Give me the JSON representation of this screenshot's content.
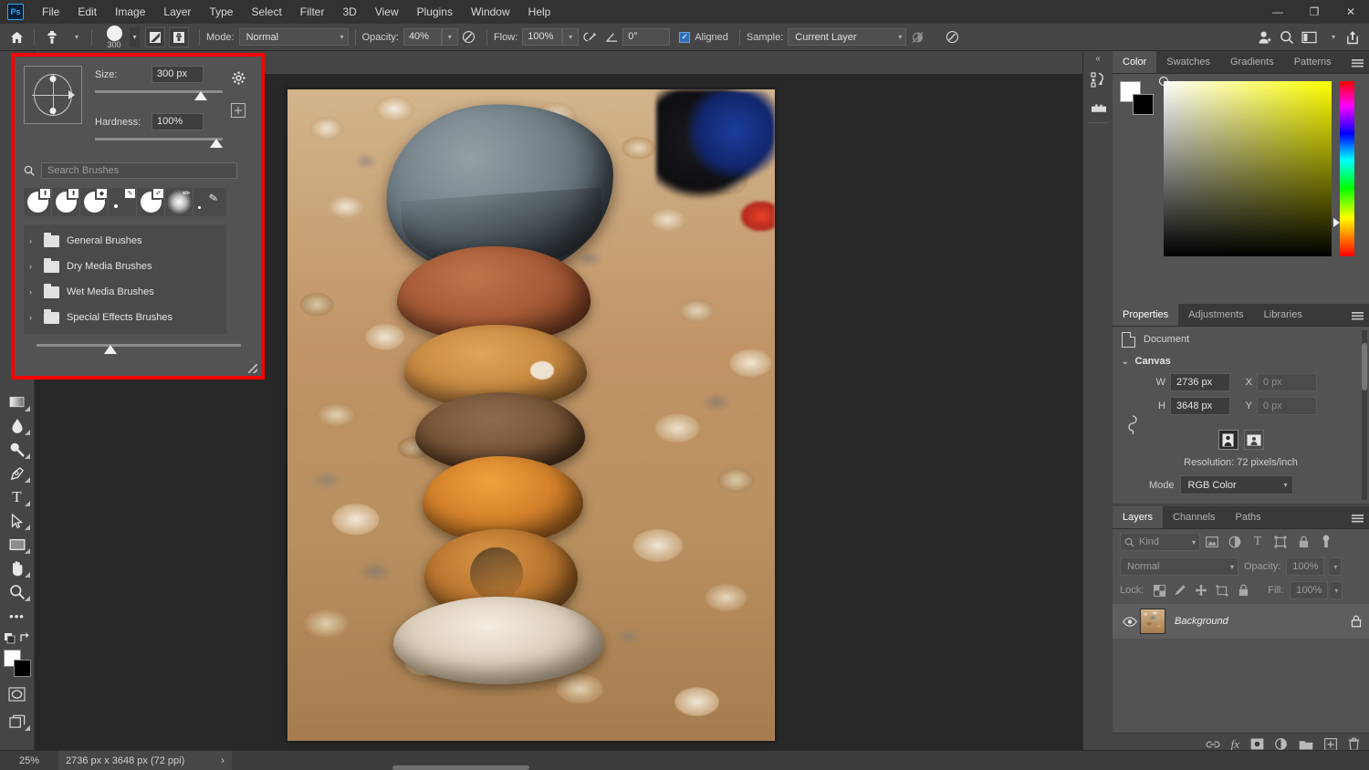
{
  "app": {
    "logo": "Ps",
    "menus": [
      "File",
      "Edit",
      "Image",
      "Layer",
      "Type",
      "Select",
      "Filter",
      "3D",
      "View",
      "Plugins",
      "Window",
      "Help"
    ],
    "window_controls": {
      "minimize": "—",
      "restore": "❐",
      "close": "✕"
    }
  },
  "options_bar": {
    "home_icon": "home-icon",
    "tool_icon": "clone-stamp-icon",
    "brush_size_value": "300",
    "mode_label": "Mode:",
    "mode_value": "Normal",
    "opacity_label": "Opacity:",
    "opacity_value": "40%",
    "flow_label": "Flow:",
    "flow_value": "100%",
    "angle_value": "0°",
    "aligned_label": "Aligned",
    "aligned_checked": true,
    "sample_label": "Sample:",
    "sample_value": "Current Layer",
    "right_icons": [
      "share-user-icon",
      "search-icon",
      "workspace-icon",
      "share-export-icon"
    ]
  },
  "toolbar": {
    "tools": [
      {
        "name": "gradient-tool",
        "glyph": "▧"
      },
      {
        "name": "blur-tool",
        "glyph": "💧"
      },
      {
        "name": "dodge-tool",
        "glyph": "🔍"
      },
      {
        "name": "pen-tool",
        "glyph": "✒"
      },
      {
        "name": "type-tool",
        "glyph": "T"
      },
      {
        "name": "path-selection-tool",
        "glyph": "➤"
      },
      {
        "name": "rectangle-tool",
        "glyph": "▭"
      },
      {
        "name": "hand-tool",
        "glyph": "✋"
      },
      {
        "name": "zoom-tool",
        "glyph": "🔎"
      },
      {
        "name": "more-tools",
        "glyph": "•••"
      }
    ],
    "foreground_color": "#ffffff",
    "background_color": "#000000",
    "quick_mask": "quick-mask-icon",
    "screen_mode": "screen-mode-icon"
  },
  "brush_panel": {
    "size_label": "Size:",
    "size_value": "300 px",
    "size_slider_pct": 80,
    "hardness_label": "Hardness:",
    "hardness_value": "100%",
    "hardness_slider_pct": 100,
    "search_placeholder": "Search Brushes",
    "gear_icon": "gear-icon",
    "new_brush_icon": "new-brush-icon",
    "presets": [
      {
        "name": "soft-round-stamp",
        "type": "hard",
        "badge": "⬆"
      },
      {
        "name": "hard-round-stamp",
        "type": "hard",
        "badge": "⬆"
      },
      {
        "name": "hard-round-pressure",
        "type": "hard",
        "badge": "◆"
      },
      {
        "name": "tiny-dot-brush",
        "type": "tiny",
        "badge": "✎"
      },
      {
        "name": "round-fan-brush",
        "type": "hard",
        "badge": "✐"
      },
      {
        "name": "soft-round-brush",
        "type": "soft",
        "badge": "✏"
      },
      {
        "name": "spatter-brush",
        "type": "scatter",
        "badge": "✎"
      }
    ],
    "folders": [
      {
        "name": "general-brushes",
        "label": "General Brushes"
      },
      {
        "name": "dry-media-brushes",
        "label": "Dry Media Brushes"
      },
      {
        "name": "wet-media-brushes",
        "label": "Wet Media Brushes"
      },
      {
        "name": "special-effects-brushes",
        "label": "Special Effects Brushes"
      }
    ],
    "bottom_slider_pct": 37,
    "highlight_color": "#ff0000"
  },
  "dock_rail": {
    "collapse_icon": "collapse-panels-icon",
    "icons": [
      {
        "name": "history-icon",
        "glyph": "↺"
      },
      {
        "name": "libraries-icon",
        "glyph": "▤"
      }
    ]
  },
  "color_panel": {
    "tabs": [
      "Color",
      "Swatches",
      "Gradients",
      "Patterns"
    ],
    "active_tab": "Color",
    "menu_icon": "panel-menu-icon",
    "foreground": "#ffffff",
    "background": "#000000",
    "selected_hue": "#ffff00",
    "marker_x_pct": 0,
    "marker_y_pct": 0,
    "hue_marker_pct": 78
  },
  "properties_panel": {
    "tabs": [
      "Properties",
      "Adjustments",
      "Libraries"
    ],
    "active_tab": "Properties",
    "menu_icon": "panel-menu-icon",
    "header_label": "Document",
    "section_label": "Canvas",
    "w_label": "W",
    "w_value": "2736 px",
    "h_label": "H",
    "h_value": "3648 px",
    "x_label": "X",
    "x_value": "0 px",
    "y_label": "Y",
    "y_value": "0 px",
    "orientation_portrait": "portrait-orientation-icon",
    "orientation_landscape": "landscape-orientation-icon",
    "resolution_text": "Resolution: 72 pixels/inch",
    "mode_label": "Mode",
    "mode_value": "RGB Color",
    "link_icon": "link-dimensions-icon"
  },
  "layers_panel": {
    "tabs": [
      "Layers",
      "Channels",
      "Paths"
    ],
    "active_tab": "Layers",
    "menu_icon": "panel-menu-icon",
    "filter_placeholder": "Kind",
    "filter_icons": [
      {
        "name": "filter-pixel-icon",
        "glyph": "▤"
      },
      {
        "name": "filter-adjustment-icon",
        "glyph": "◑"
      },
      {
        "name": "filter-type-icon",
        "glyph": "T"
      },
      {
        "name": "filter-shape-icon",
        "glyph": "⬚"
      },
      {
        "name": "filter-smart-object-icon",
        "glyph": "🔒"
      },
      {
        "name": "filter-toggle-icon",
        "glyph": "●"
      }
    ],
    "blend_mode": "Normal",
    "opacity_label": "Opacity:",
    "opacity_value": "100%",
    "lock_label": "Lock:",
    "lock_icons": [
      {
        "name": "lock-transparent-pixels-icon",
        "glyph": "▦"
      },
      {
        "name": "lock-image-pixels-icon",
        "glyph": "🖌"
      },
      {
        "name": "lock-position-icon",
        "glyph": "✛"
      },
      {
        "name": "lock-artboard-nesting-icon",
        "glyph": "⬚"
      },
      {
        "name": "lock-all-icon",
        "glyph": "🔒"
      }
    ],
    "fill_label": "Fill:",
    "fill_value": "100%",
    "layers": [
      {
        "name": "Background",
        "visible": true,
        "locked": true
      }
    ],
    "bottom_icons": [
      {
        "name": "link-layers-icon",
        "glyph": "🔗"
      },
      {
        "name": "layer-style-icon",
        "glyph": "fx"
      },
      {
        "name": "layer-mask-icon",
        "glyph": "◉"
      },
      {
        "name": "adjustment-layer-icon",
        "glyph": "◑"
      },
      {
        "name": "new-group-icon",
        "glyph": "▰"
      },
      {
        "name": "new-layer-icon",
        "glyph": "＋"
      },
      {
        "name": "delete-layer-icon",
        "glyph": "🗑"
      }
    ]
  },
  "status_bar": {
    "zoom": "25%",
    "doc_info": "2736 px x 3648 px (72 ppi)",
    "expand_arrow": "›"
  },
  "canvas": {
    "document_title": "",
    "image_description": "Stack of balanced beach stones (cairn) on pebble shingle"
  }
}
